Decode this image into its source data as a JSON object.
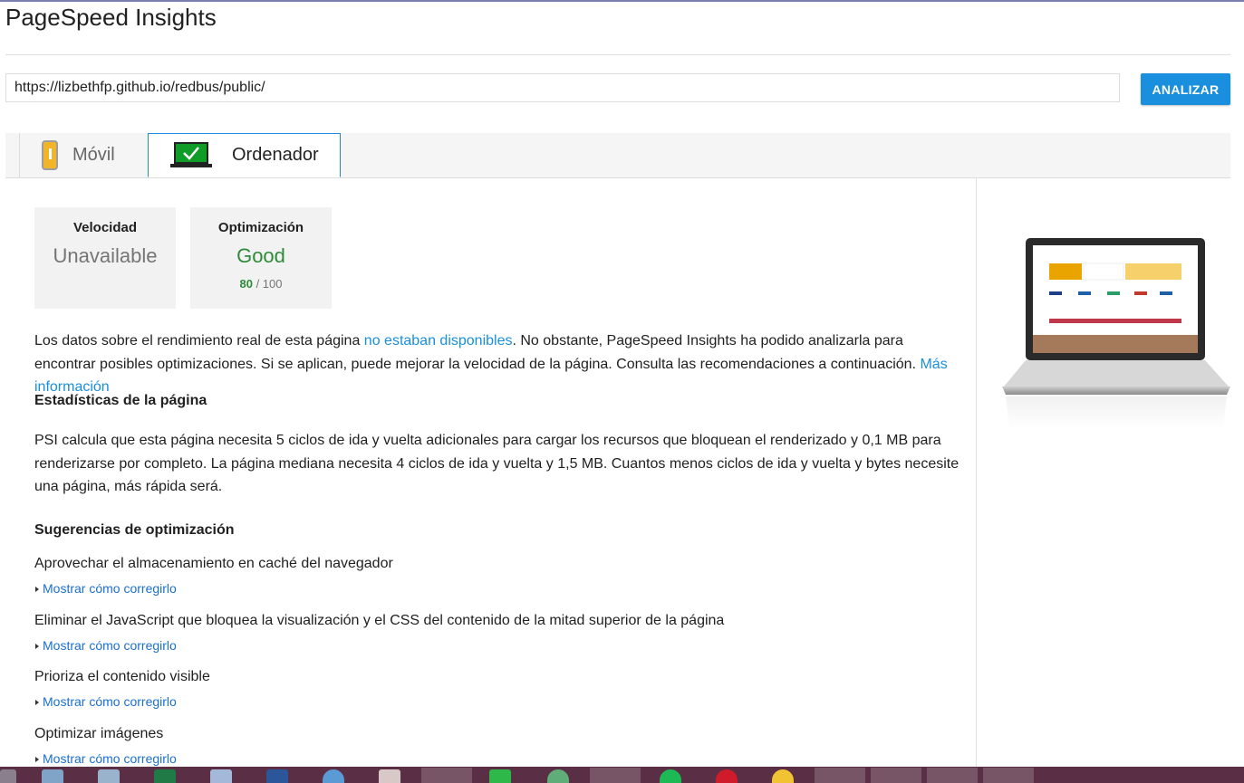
{
  "app": {
    "title": "PageSpeed Insights"
  },
  "search": {
    "url": "https://lizbethfp.github.io/redbus/public/",
    "analyze_label": "ANALIZAR"
  },
  "tabs": [
    {
      "label": "Móvil",
      "icon": "phone-warning-icon",
      "selected": false
    },
    {
      "label": "Ordenador",
      "icon": "laptop-check-icon",
      "selected": true
    }
  ],
  "scores": {
    "speed": {
      "title": "Velocidad",
      "value": "Unavailable"
    },
    "optimization": {
      "title": "Optimización",
      "value": "Good",
      "score": "80",
      "max": "/ 100"
    }
  },
  "intro": {
    "text1": "Los datos sobre el rendimiento real de esta página ",
    "link1": "no estaban disponibles",
    "text2": ". No obstante, PageSpeed Insights ha podido analizarla para encontrar posibles optimizaciones. Si se aplican, puede mejorar la velocidad de la página. Consulta las recomendaciones a continuación. ",
    "link2": "Más información"
  },
  "stats": {
    "heading": "Estadísticas de la página",
    "text": "PSI calcula que esta página necesita 5 ciclos de ida y vuelta adicionales para cargar los recursos que bloquean el renderizado y 0,1 MB para renderizarse por completo. La página mediana necesita 4 ciclos de ida y vuelta y 1,5 MB. Cuantos menos ciclos de ida y vuelta y bytes necesite una página, más rápida será."
  },
  "suggestions": {
    "heading": "Sugerencias de optimización",
    "fix_label": "Mostrar cómo corregirlo",
    "items": [
      "Aprovechar el almacenamiento en caché del navegador",
      "Eliminar el JavaScript que bloquea la visualización y el CSS del contenido de la mitad superior de la página",
      "Prioriza el contenido visible",
      "Optimizar imágenes"
    ]
  },
  "colors": {
    "accent": "#1a8fde",
    "good": "#2e8b3a",
    "taskbar": "#5a2f45"
  }
}
